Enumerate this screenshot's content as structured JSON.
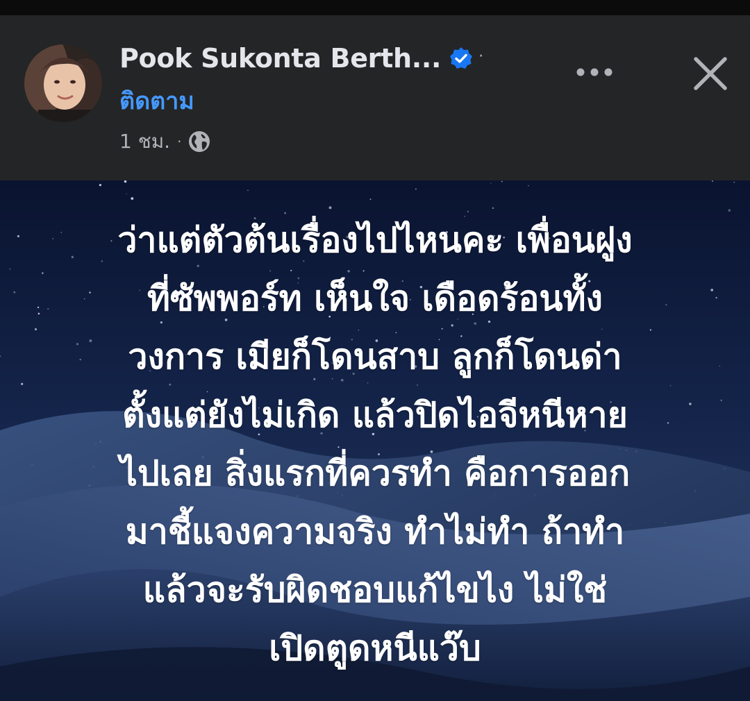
{
  "post": {
    "author": "Pook Sukonta Berth...",
    "verified_icon": "verified-badge-icon",
    "follow_label": "ติดตาม",
    "time": "1 ชม.",
    "privacy_icon": "globe-icon",
    "more_icon": "more-options-icon",
    "close_icon": "close-icon",
    "text_lines": [
      "ว่าแต่ตัวต้นเรื่องไปไหนคะ เพื่อนฝูง",
      "ที่ซัพพอร์ท เห็นใจ เดือดร้อนทั้ง",
      "วงการ เมียก็โดนสาบ ลูกก็โดนด่า",
      "ตั้งแต่ยังไม่เกิด แล้วปิดไอจีหนีหาย",
      "ไปเลย สิ่งแรกที่ควรทำ คือการออก",
      "มาชี้แจงความจริง ทำไม่ทำ ถ้าทำ",
      "แล้วจะรับผิดชอบแก้ไขไง ไม่ใช่",
      "เปิดตูดหนีแว๊บ"
    ]
  },
  "colors": {
    "header_bg": "#242526",
    "name_text": "#e4e6eb",
    "follow_text": "#4599ff",
    "meta_text": "#b0b3b8",
    "verified": "#1877f2",
    "post_bg_top": "#0c1631",
    "post_bg_bottom": "#2d4168"
  }
}
